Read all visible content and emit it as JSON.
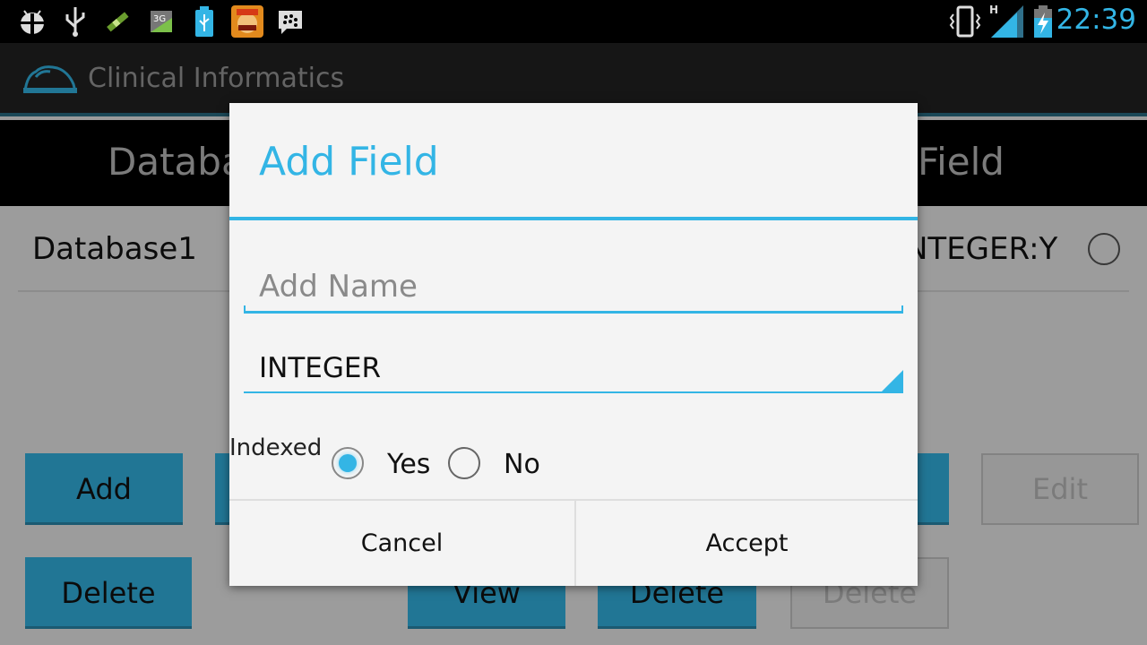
{
  "status_bar": {
    "time": "22:39",
    "network_type": "H",
    "left_icons": [
      "android-debug-icon",
      "usb-icon",
      "signal-tool-icon",
      "3g-icon",
      "battery-usb-icon",
      "clash-game-icon",
      "bbm-icon"
    ],
    "left_icon_text": "3G",
    "right_icons": [
      "vibrate-icon",
      "cell-signal-icon",
      "battery-charging-icon"
    ],
    "accent": "#33b5e5"
  },
  "action_bar": {
    "title": "Clinical Informatics"
  },
  "column_header": {
    "left_text": "Databa",
    "right_text": "Field"
  },
  "content": {
    "row_name": "Database1",
    "row_type": "NTEGER:Y",
    "buttons": [
      {
        "label": "Add",
        "enabled": true
      },
      {
        "label": "Delete",
        "enabled": true
      },
      {
        "label": "View",
        "enabled": true
      },
      {
        "label": "Delete",
        "enabled": true
      },
      {
        "label": "Edit",
        "enabled": false
      },
      {
        "label": "Delete",
        "enabled": false
      }
    ]
  },
  "dialog": {
    "title": "Add Field",
    "name_input": {
      "value": "",
      "placeholder": "Add Name"
    },
    "type_spinner": {
      "selected": "INTEGER"
    },
    "indexed": {
      "label": "Indexed",
      "options": [
        {
          "label": "Yes",
          "checked": true
        },
        {
          "label": "No",
          "checked": false
        }
      ]
    },
    "cancel_label": "Cancel",
    "accept_label": "Accept"
  }
}
